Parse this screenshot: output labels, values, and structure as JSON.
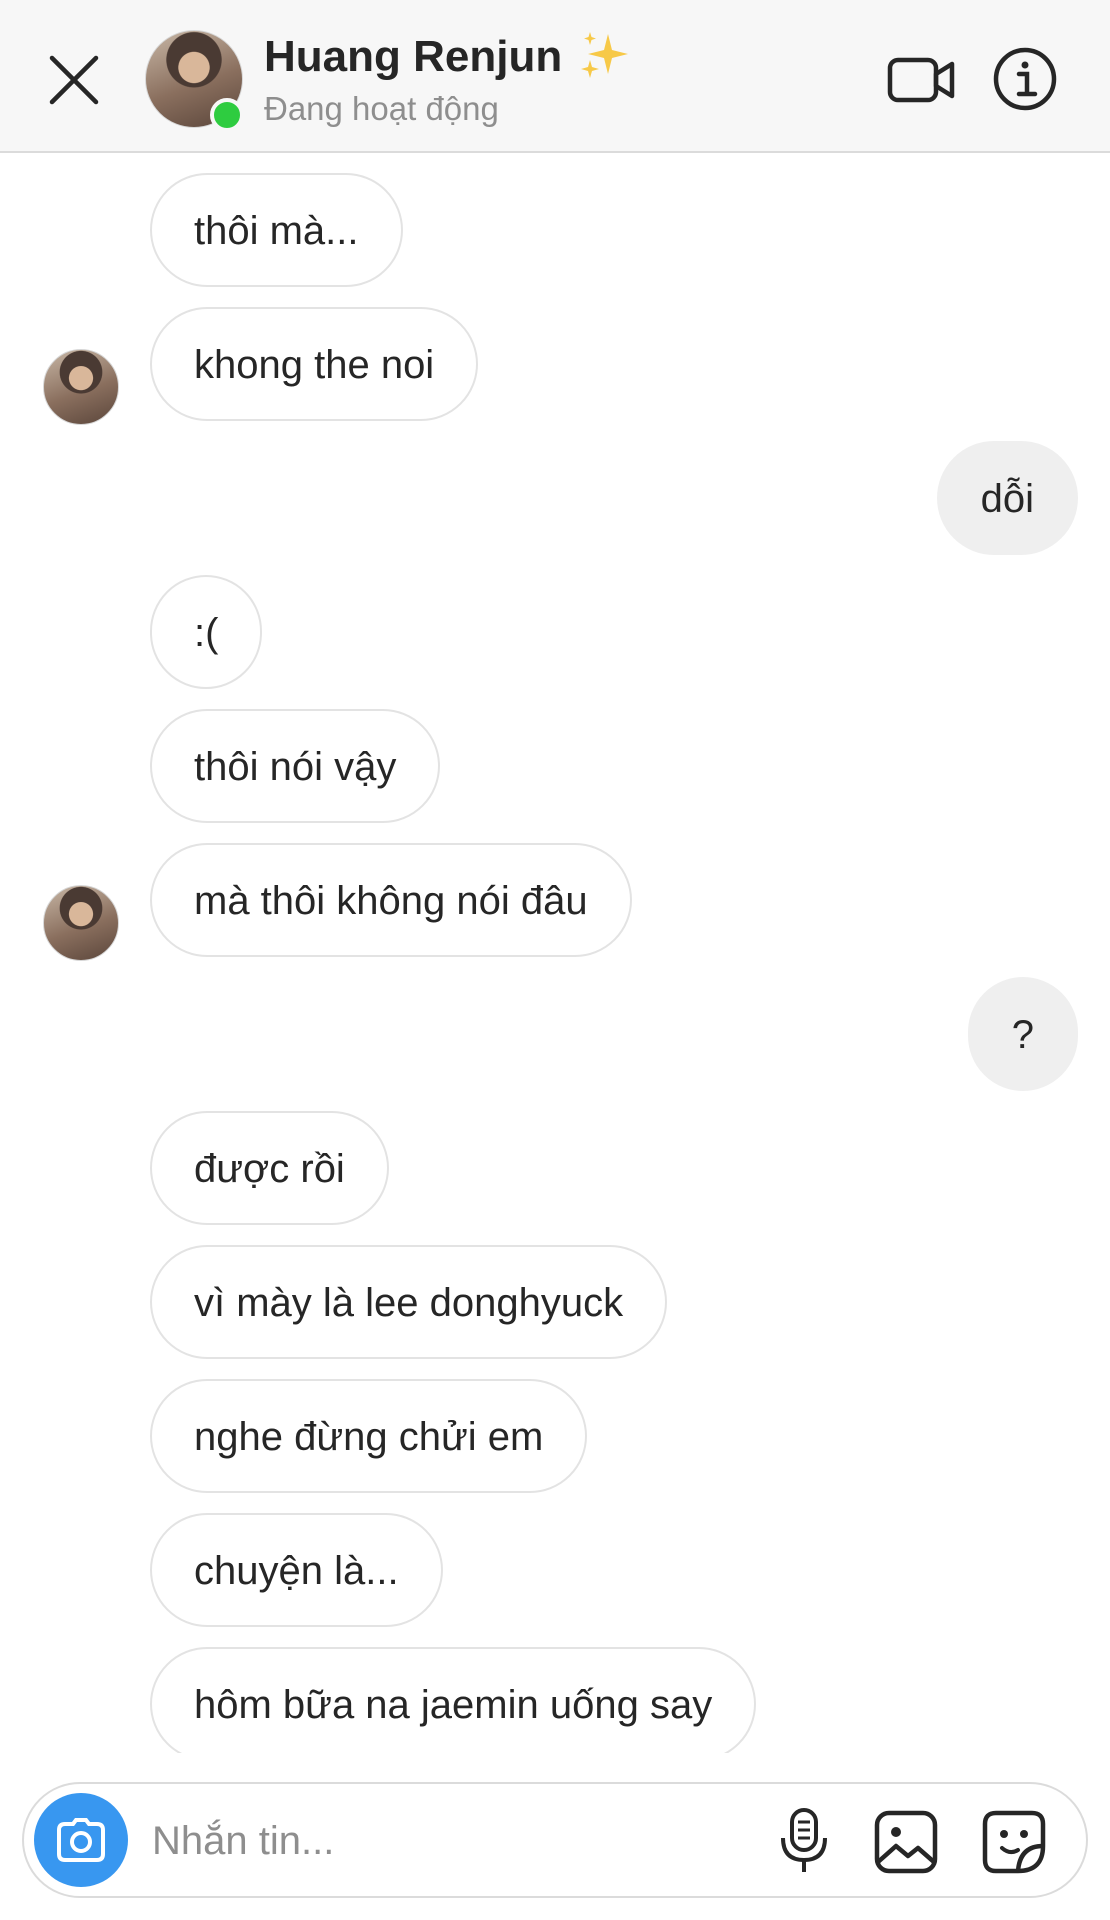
{
  "header": {
    "contact_name": "Huang Renjun",
    "status": "Đang hoạt động",
    "status_color": "#2ecc40"
  },
  "messages": [
    {
      "id": "m1",
      "direction": "incoming",
      "text": "thôi mà..."
    },
    {
      "id": "m2",
      "direction": "incoming",
      "text": "khong the noi",
      "avatar": true
    },
    {
      "id": "m3",
      "direction": "outgoing",
      "text": "dỗi"
    },
    {
      "id": "m4",
      "direction": "incoming",
      "text": ":("
    },
    {
      "id": "m5",
      "direction": "incoming",
      "text": "thôi nói vậy"
    },
    {
      "id": "m6",
      "direction": "incoming",
      "text": "mà thôi không nói đâu",
      "avatar": true
    },
    {
      "id": "m7",
      "direction": "outgoing",
      "text": "?"
    },
    {
      "id": "m8",
      "direction": "incoming",
      "text": "được rồi"
    },
    {
      "id": "m9",
      "direction": "incoming",
      "text": "vì mày là lee donghyuck"
    },
    {
      "id": "m10",
      "direction": "incoming",
      "text": "nghe đừng chửi em"
    },
    {
      "id": "m11",
      "direction": "incoming",
      "text": "chuyện là..."
    },
    {
      "id": "m12",
      "direction": "incoming",
      "text": "hôm bữa na jaemin uống say"
    }
  ],
  "composer": {
    "placeholder": "Nhắn tin...",
    "value": ""
  },
  "icons": {
    "close": "close-icon",
    "video": "video-camera-icon",
    "info": "info-icon",
    "camera": "camera-icon",
    "mic": "microphone-icon",
    "gallery": "gallery-icon",
    "sticker": "sticker-icon",
    "sparkle": "sparkles-emoji-icon"
  },
  "colors": {
    "accent": "#3897f0",
    "incoming_bubble": "#ffffff",
    "outgoing_bubble": "#efefef",
    "online": "#2ecc40"
  }
}
